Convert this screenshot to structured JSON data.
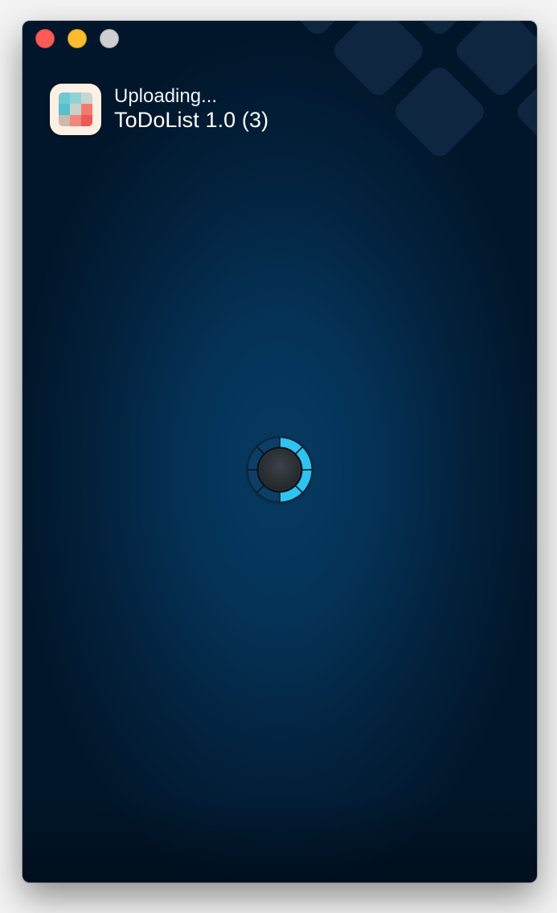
{
  "window": {
    "controls": {
      "close_icon": "close-icon",
      "minimize_icon": "minimize-icon",
      "zoom_icon": "zoom-icon"
    }
  },
  "header": {
    "status": "Uploading...",
    "app_name": "ToDoList 1.0 (3)",
    "app_icon": "todolist-app-icon"
  },
  "progress": {
    "icon": "progress-ring-icon",
    "fraction": 0.5
  },
  "colors": {
    "accent": "#2ec3f0",
    "window_background": "#063a61",
    "traffic_close": "#fd5b57",
    "traffic_minimize": "#fdbc2e",
    "traffic_zoom": "#cfcfcf"
  }
}
